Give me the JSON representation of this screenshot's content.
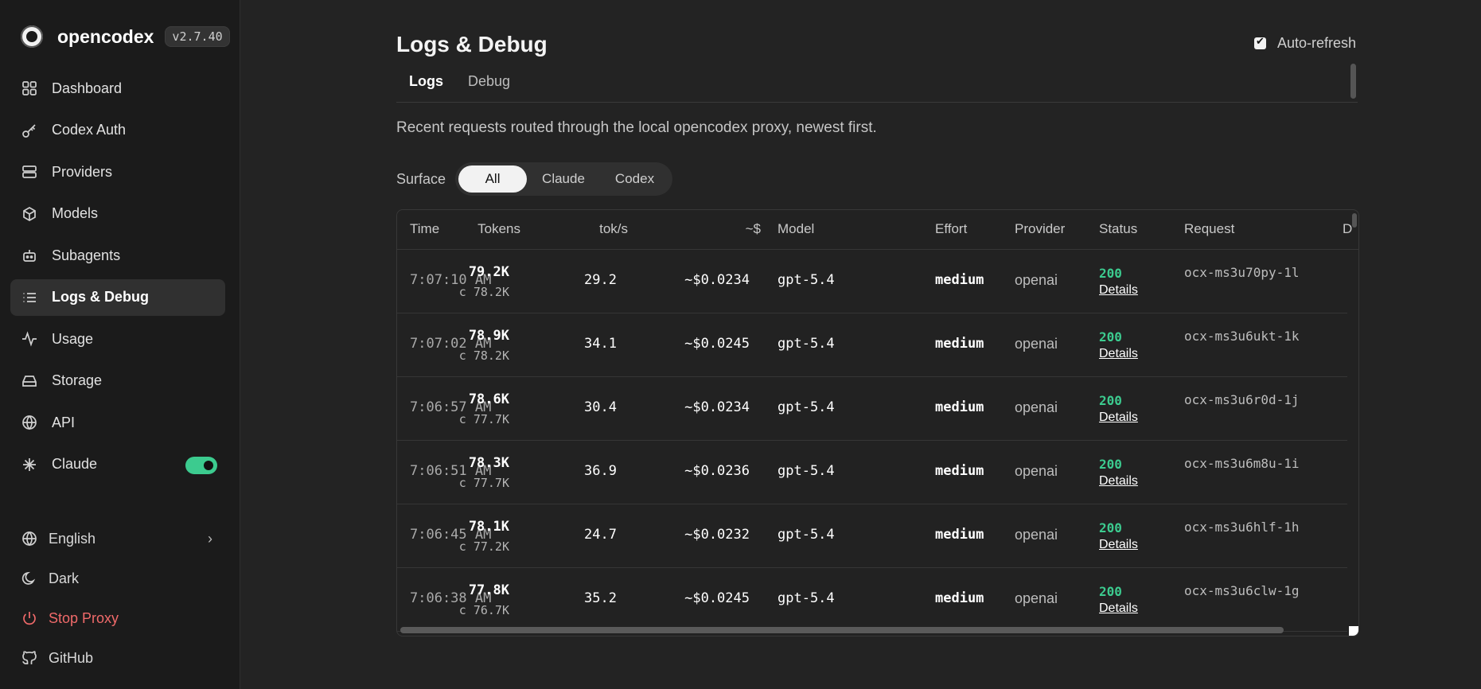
{
  "app": {
    "name": "opencodex",
    "version": "v2.7.40"
  },
  "sidebar": {
    "items": [
      {
        "label": "Dashboard",
        "icon": "grid-icon"
      },
      {
        "label": "Codex Auth",
        "icon": "key-icon"
      },
      {
        "label": "Providers",
        "icon": "server-icon"
      },
      {
        "label": "Models",
        "icon": "cube-icon"
      },
      {
        "label": "Subagents",
        "icon": "bot-icon"
      },
      {
        "label": "Logs & Debug",
        "icon": "list-icon"
      },
      {
        "label": "Usage",
        "icon": "activity-icon"
      },
      {
        "label": "Storage",
        "icon": "drive-icon"
      },
      {
        "label": "API",
        "icon": "globe-icon"
      },
      {
        "label": "Claude",
        "icon": "asterisk-icon",
        "toggle": true
      }
    ],
    "bottom": {
      "language": "English",
      "theme": "Dark",
      "stop": "Stop Proxy",
      "github": "GitHub"
    }
  },
  "main": {
    "title": "Logs & Debug",
    "auto_refresh": "Auto-refresh",
    "tabs": [
      "Logs",
      "Debug"
    ],
    "subtitle": "Recent requests routed through the local opencodex proxy, newest first.",
    "surface_label": "Surface",
    "surface_options": [
      "All",
      "Claude",
      "Codex"
    ]
  },
  "table": {
    "headers": [
      "Time",
      "Tokens",
      "tok/s",
      "~$",
      "Model",
      "Effort",
      "Provider",
      "Status",
      "Request",
      "D"
    ],
    "rows": [
      {
        "time": "7:07:10 AM",
        "tokens": "79.2K",
        "cached": "c 78.2K",
        "tps": "29.2",
        "cost": "~$0.0234",
        "model": "gpt-5.4",
        "effort": "medium",
        "provider": "openai",
        "status": "200",
        "details": "Details",
        "request": "ocx-ms3u70py-1l"
      },
      {
        "time": "7:07:02 AM",
        "tokens": "78.9K",
        "cached": "c 78.2K",
        "tps": "34.1",
        "cost": "~$0.0245",
        "model": "gpt-5.4",
        "effort": "medium",
        "provider": "openai",
        "status": "200",
        "details": "Details",
        "request": "ocx-ms3u6ukt-1k"
      },
      {
        "time": "7:06:57 AM",
        "tokens": "78.6K",
        "cached": "c 77.7K",
        "tps": "30.4",
        "cost": "~$0.0234",
        "model": "gpt-5.4",
        "effort": "medium",
        "provider": "openai",
        "status": "200",
        "details": "Details",
        "request": "ocx-ms3u6r0d-1j"
      },
      {
        "time": "7:06:51 AM",
        "tokens": "78.3K",
        "cached": "c 77.7K",
        "tps": "36.9",
        "cost": "~$0.0236",
        "model": "gpt-5.4",
        "effort": "medium",
        "provider": "openai",
        "status": "200",
        "details": "Details",
        "request": "ocx-ms3u6m8u-1i"
      },
      {
        "time": "7:06:45 AM",
        "tokens": "78.1K",
        "cached": "c 77.2K",
        "tps": "24.7",
        "cost": "~$0.0232",
        "model": "gpt-5.4",
        "effort": "medium",
        "provider": "openai",
        "status": "200",
        "details": "Details",
        "request": "ocx-ms3u6hlf-1h"
      },
      {
        "time": "7:06:38 AM",
        "tokens": "77.8K",
        "cached": "c 76.7K",
        "tps": "35.2",
        "cost": "~$0.0245",
        "model": "gpt-5.4",
        "effort": "medium",
        "provider": "openai",
        "status": "200",
        "details": "Details",
        "request": "ocx-ms3u6clw-1g"
      }
    ]
  },
  "colors": {
    "accent_green": "#3ccb8f",
    "danger": "#f06a6a",
    "background": "#232323",
    "sidebar": "#1b1b1b"
  }
}
